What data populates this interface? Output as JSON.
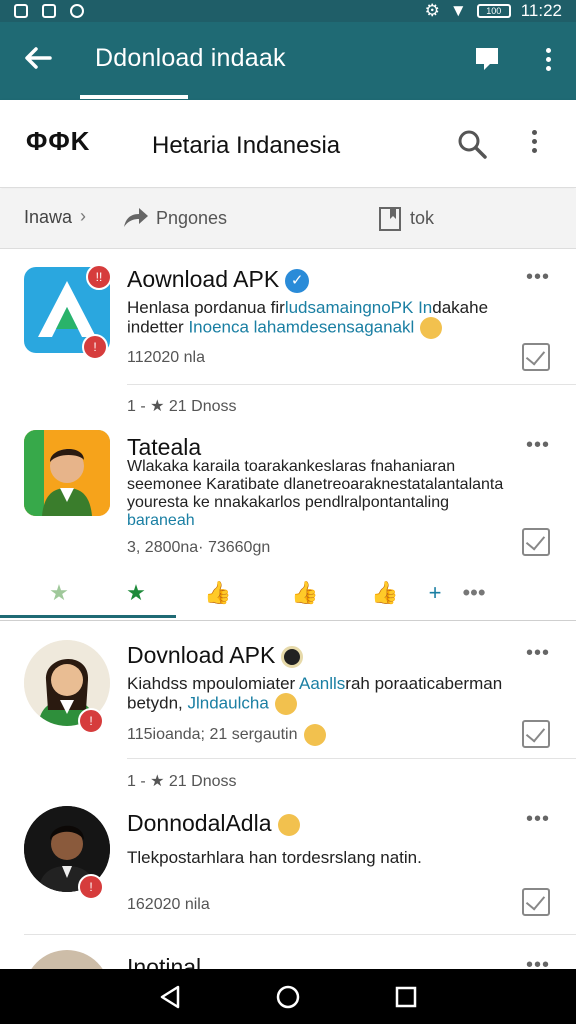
{
  "status_bar": {
    "time": "11:22",
    "battery": "100"
  },
  "app_bar": {
    "title": "Ddonload indaak"
  },
  "search_header": {
    "logo": "ΦΦK",
    "heading": "Hetaria Indanesia"
  },
  "breadcrumbs": {
    "first": "Inawa",
    "second": "Pngones",
    "third": "tok"
  },
  "posts": [
    {
      "title": "Aownload APK",
      "body_plain_1": "Henlasa pordanua fir",
      "body_link_1": "ludsamaingnoPK In",
      "body_plain_2": "dakahe",
      "body_plain_3": "indetter ",
      "body_link_2": "Inoenca lahamdesensaganakl",
      "meta": "112020 nla",
      "stats": "1 -  ★ 21 Dnoss"
    },
    {
      "title": "Tateala",
      "body_plain_1": "Wlakaka karaila toarakankeslaras fnahaniaran",
      "body_plain_2": "seemonee Karatibate dlanetreoaraknestatalantalanta",
      "body_plain_3": "youresta ke nnakakarlos pendlralpontantaling",
      "body_link_1": "baraneah",
      "meta": "3, 2800na· 73660gn"
    },
    {
      "title": "Dovnload APK",
      "body_plain_1": "Kiahdss mpoulomiater ",
      "body_link_1": "Aanlls",
      "body_plain_2": "rah poraaticaberman",
      "body_plain_3": "betydn, ",
      "body_link_2": "Jlndaulcha",
      "meta": "115ioanda; 21 sergautin",
      "stats": "1 -  ★ 21 Dnoss"
    },
    {
      "title": "DonnodalAdla",
      "body_plain_1": "Tlekpostarhlara han tordesrslang natin.",
      "meta": "162020 nila"
    },
    {
      "title": "Inotinal"
    }
  ],
  "colors": {
    "app_bar": "#1f6a74",
    "status_bar": "#1f5e68",
    "accent_green": "#1e8a3a",
    "link": "#1a7fa3"
  }
}
